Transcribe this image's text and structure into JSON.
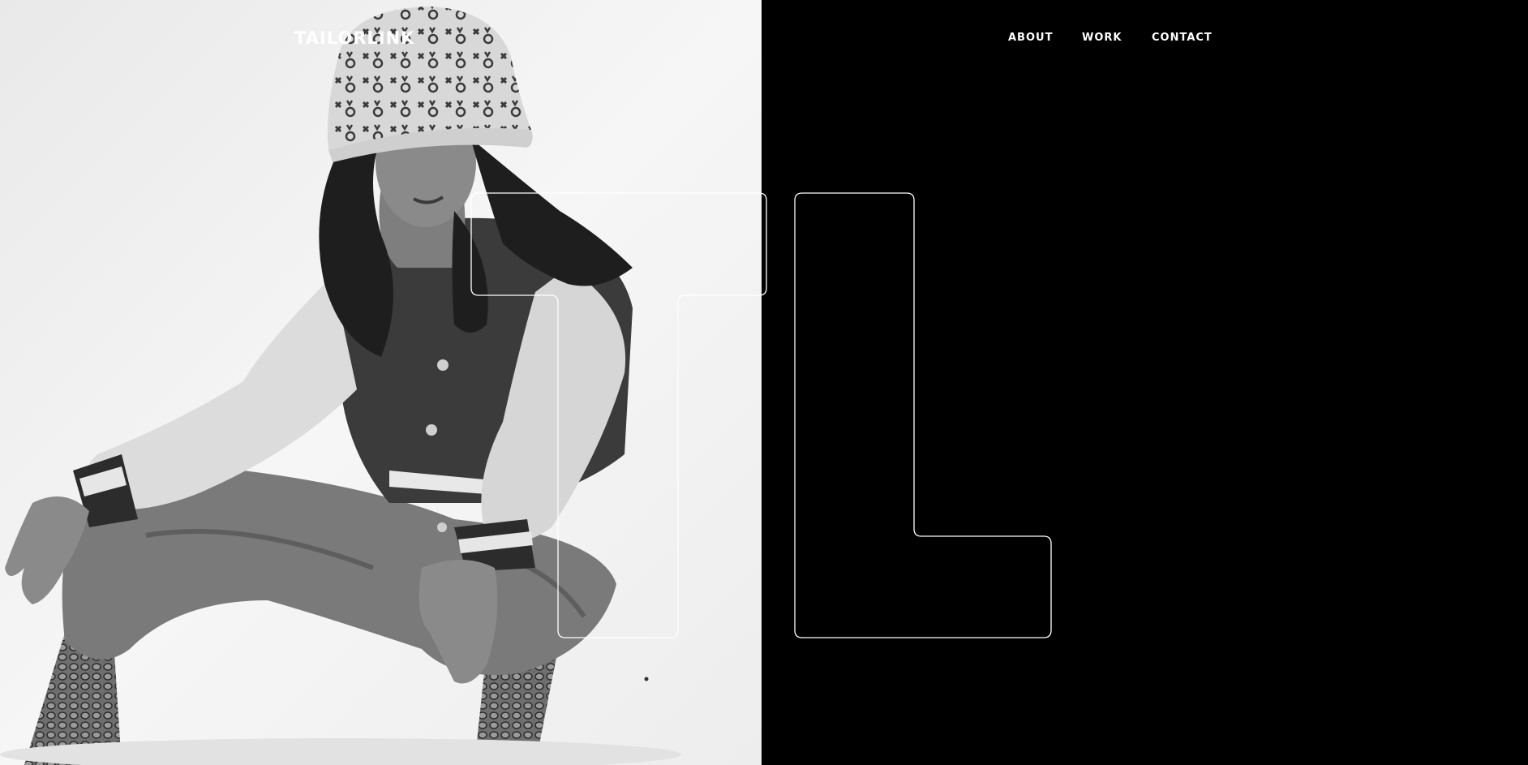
{
  "header": {
    "brand": "TAILORLINK",
    "nav": [
      {
        "label": "ABOUT"
      },
      {
        "label": "WORK"
      },
      {
        "label": "CONTACT"
      }
    ]
  },
  "hero": {
    "monogram_letters": "TL",
    "photo": "black-and-white portrait photo"
  },
  "colors": {
    "left_background": "#f3f3f3",
    "right_background": "#000000",
    "text": "#ffffff",
    "outline": "#ffffff"
  }
}
